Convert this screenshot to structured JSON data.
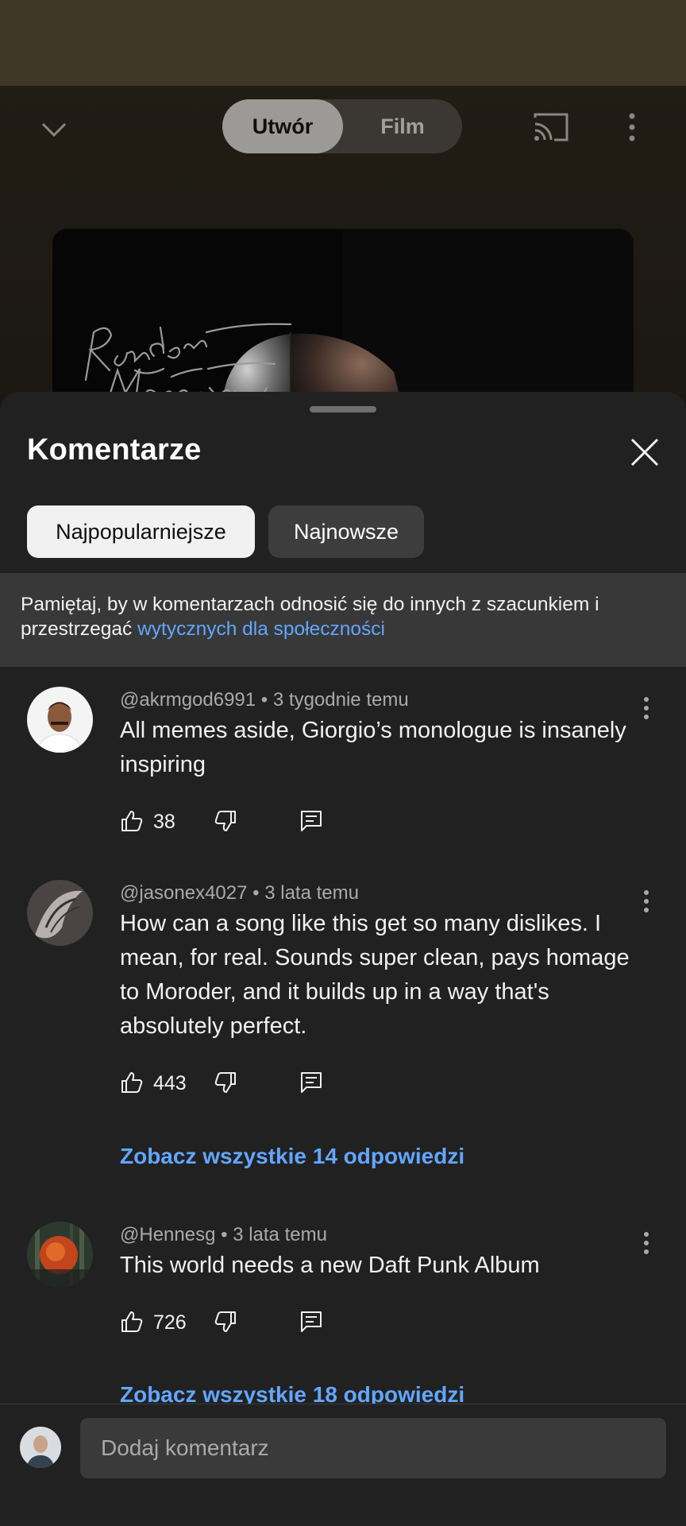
{
  "player": {
    "tabs": [
      {
        "label": "Utwór",
        "active": true
      },
      {
        "label": "Film",
        "active": false
      }
    ],
    "icons": {
      "collapse": "chevron-down-icon",
      "cast": "cast-icon",
      "menu": "more-vert-icon"
    }
  },
  "comments_panel": {
    "title": "Komentarze",
    "sort_chips": [
      {
        "label": "Najpopularniejsze",
        "active": true
      },
      {
        "label": "Najnowsze",
        "active": false
      }
    ],
    "notice": {
      "text": "Pamiętaj, by w komentarzach odnosić się do innych z szacunkiem i przestrzegać ",
      "link": "wytycznych dla społeczności"
    },
    "comments": [
      {
        "author": "@akrmgod6991",
        "time": "3 tygodnie temu",
        "text": "All memes aside, Giorgio’s monologue is insanely inspiring",
        "likes": "38",
        "replies_label": ""
      },
      {
        "author": "@jasonex4027",
        "time": "3 lata temu",
        "text": "How can a song like this get so many dislikes. I mean, for real. Sounds super clean, pays homage to Moroder, and it builds up in a way that's absolutely perfect.",
        "likes": "443",
        "replies_label": "Zobacz wszystkie 14 odpowiedzi"
      },
      {
        "author": "@Hennesg",
        "time": "3 lata temu",
        "text": "This world needs a new Daft Punk Album",
        "likes": "726",
        "replies_label": "Zobacz wszystkie 18 odpowiedzi"
      }
    ],
    "input_placeholder": "Dodaj komentarz"
  },
  "colors": {
    "sheet_bg": "#212121",
    "link_blue": "#62a6ff",
    "notice_bg": "#383838"
  }
}
